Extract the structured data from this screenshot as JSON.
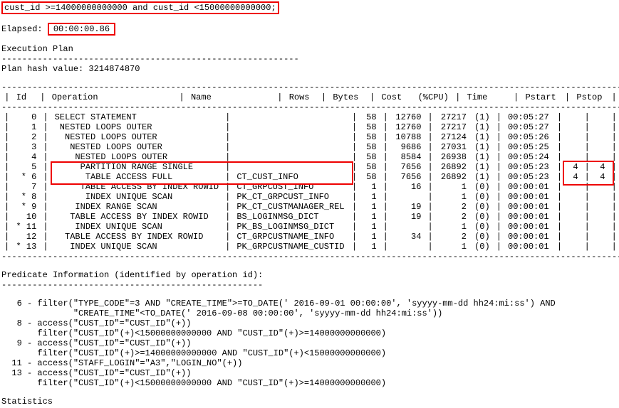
{
  "top_predicate": "cust_id >=14000000000000 and cust_id <15000000000000;",
  "elapsed_label": "Elapsed:",
  "elapsed_value": "00:00:00.86",
  "exec_plan_label": "Execution Plan",
  "plan_hash_label": "Plan hash value: 3214874870",
  "dash_line": "----------------------------------------------------------",
  "headers": {
    "id": "Id",
    "op": "Operation",
    "name": "Name",
    "rows": "Rows",
    "bytes": "Bytes",
    "cost": "Cost",
    "cpu": "(%CPU)",
    "time": "Time",
    "pstart": "Pstart",
    "pstop": "Pstop"
  },
  "sep_row": "-------------------------------------------------------------------------------------------------------------------------------",
  "plan_rows": [
    {
      "mark": "",
      "id": "0",
      "op": "SELECT STATEMENT",
      "name": "",
      "rows": "58",
      "bytes": "12760",
      "cost": "27217",
      "cpu": "(1)",
      "time": "00:05:27",
      "pstart": "",
      "pstop": ""
    },
    {
      "mark": "",
      "id": "1",
      "op": " NESTED LOOPS OUTER",
      "name": "",
      "rows": "58",
      "bytes": "12760",
      "cost": "27217",
      "cpu": "(1)",
      "time": "00:05:27",
      "pstart": "",
      "pstop": ""
    },
    {
      "mark": "",
      "id": "2",
      "op": "  NESTED LOOPS OUTER",
      "name": "",
      "rows": "58",
      "bytes": "10788",
      "cost": "27124",
      "cpu": "(1)",
      "time": "00:05:26",
      "pstart": "",
      "pstop": ""
    },
    {
      "mark": "",
      "id": "3",
      "op": "   NESTED LOOPS OUTER",
      "name": "",
      "rows": "58",
      "bytes": "9686",
      "cost": "27031",
      "cpu": "(1)",
      "time": "00:05:25",
      "pstart": "",
      "pstop": ""
    },
    {
      "mark": "",
      "id": "4",
      "op": "    NESTED LOOPS OUTER",
      "name": "",
      "rows": "58",
      "bytes": "8584",
      "cost": "26938",
      "cpu": "(1)",
      "time": "00:05:24",
      "pstart": "",
      "pstop": ""
    },
    {
      "mark": "",
      "id": "5",
      "op": "     PARTITION RANGE SINGLE",
      "name": "",
      "rows": "58",
      "bytes": "7656",
      "cost": "26892",
      "cpu": "(1)",
      "time": "00:05:23",
      "pstart": "4",
      "pstop": "4",
      "hi_op": true,
      "hi_p": true
    },
    {
      "mark": "*",
      "id": "6",
      "op": "      TABLE ACCESS FULL",
      "name": "CT_CUST_INFO",
      "rows": "58",
      "bytes": "7656",
      "cost": "26892",
      "cpu": "(1)",
      "time": "00:05:23",
      "pstart": "4",
      "pstop": "4",
      "hi_op": true,
      "hi_p": true
    },
    {
      "mark": "",
      "id": "7",
      "op": "     TABLE ACCESS BY INDEX ROWID",
      "name": "CT_GRPCUST_INFO",
      "rows": "1",
      "bytes": "16",
      "cost": "1",
      "cpu": "(0)",
      "time": "00:00:01",
      "pstart": "",
      "pstop": ""
    },
    {
      "mark": "*",
      "id": "8",
      "op": "      INDEX UNIQUE SCAN",
      "name": "PK_CT_GRPCUST_INFO",
      "rows": "1",
      "bytes": "",
      "cost": "1",
      "cpu": "(0)",
      "time": "00:00:01",
      "pstart": "",
      "pstop": ""
    },
    {
      "mark": "*",
      "id": "9",
      "op": "    INDEX RANGE SCAN",
      "name": "PK_CT_CUSTMANAGER_REL",
      "rows": "1",
      "bytes": "19",
      "cost": "2",
      "cpu": "(0)",
      "time": "00:00:01",
      "pstart": "",
      "pstop": ""
    },
    {
      "mark": "",
      "id": "10",
      "op": "   TABLE ACCESS BY INDEX ROWID",
      "name": "BS_LOGINMSG_DICT",
      "rows": "1",
      "bytes": "19",
      "cost": "2",
      "cpu": "(0)",
      "time": "00:00:01",
      "pstart": "",
      "pstop": ""
    },
    {
      "mark": "*",
      "id": "11",
      "op": "    INDEX UNIQUE SCAN",
      "name": "PK_BS_LOGINMSG_DICT",
      "rows": "1",
      "bytes": "",
      "cost": "1",
      "cpu": "(0)",
      "time": "00:00:01",
      "pstart": "",
      "pstop": ""
    },
    {
      "mark": "",
      "id": "12",
      "op": "  TABLE ACCESS BY INDEX ROWID",
      "name": "CT_GRPCUSTNAME_INFO",
      "rows": "1",
      "bytes": "34",
      "cost": "2",
      "cpu": "(0)",
      "time": "00:00:01",
      "pstart": "",
      "pstop": ""
    },
    {
      "mark": "*",
      "id": "13",
      "op": "   INDEX UNIQUE SCAN",
      "name": "PK_GRPCUSTNAME_CUSTID",
      "rows": "1",
      "bytes": "",
      "cost": "1",
      "cpu": "(0)",
      "time": "00:00:01",
      "pstart": "",
      "pstop": ""
    }
  ],
  "pred_info_label": "Predicate Information (identified by operation id):",
  "pred_dash": "---------------------------------------------------",
  "predicates": [
    "   6 - filter(\"TYPE_CODE\"=3 AND \"CREATE_TIME\">=TO_DATE(' 2016-09-01 00:00:00', 'syyyy-mm-dd hh24:mi:ss') AND",
    "              \"CREATE_TIME\"<TO_DATE(' 2016-09-08 00:00:00', 'syyyy-mm-dd hh24:mi:ss'))",
    "   8 - access(\"CUST_ID\"=\"CUST_ID\"(+))",
    "       filter(\"CUST_ID\"(+)<15000000000000 AND \"CUST_ID\"(+)>=14000000000000)",
    "   9 - access(\"CUST_ID\"=\"CUST_ID\"(+))",
    "       filter(\"CUST_ID\"(+)>=14000000000000 AND \"CUST_ID\"(+)<15000000000000)",
    "  11 - access(\"STAFF_LOGIN\"=\"A3\",\"LOGIN_NO\"(+))",
    "  13 - access(\"CUST_ID\"=\"CUST_ID\"(+))",
    "       filter(\"CUST_ID\"(+)<15000000000000 AND \"CUST_ID\"(+)>=14000000000000)"
  ],
  "stats_label": "Statistics"
}
